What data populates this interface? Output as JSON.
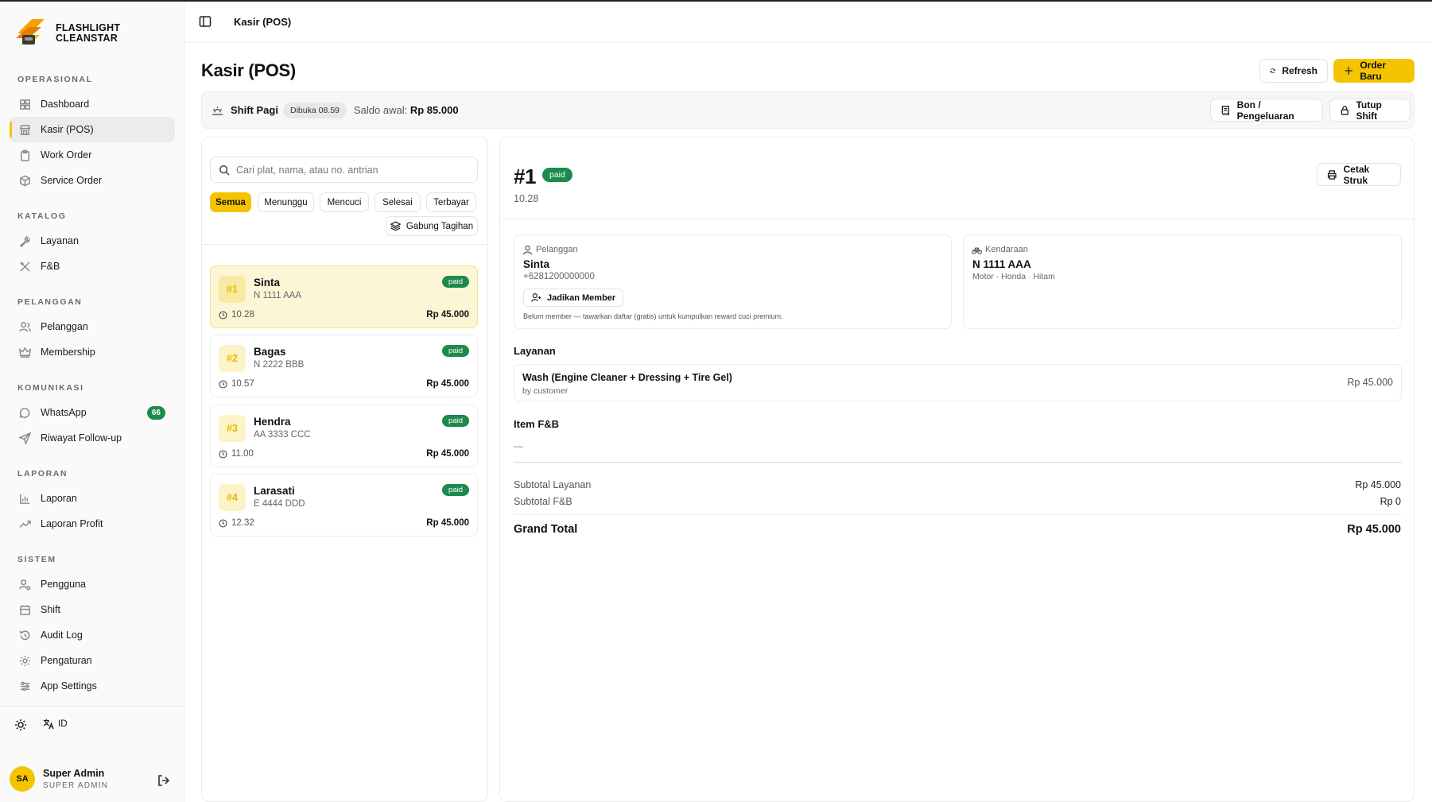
{
  "brand": {
    "line1": "FLASHLIGHT",
    "line2": "CLEANSTAR"
  },
  "header": {
    "title": "Kasir (POS)"
  },
  "sidebar": {
    "sections": [
      {
        "title": "OPERASIONAL",
        "items": [
          {
            "label": "Dashboard",
            "icon": "grid-icon"
          },
          {
            "label": "Kasir (POS)",
            "icon": "store-icon",
            "active": true
          },
          {
            "label": "Work Order",
            "icon": "clipboard-icon"
          },
          {
            "label": "Service Order",
            "icon": "box-icon"
          }
        ]
      },
      {
        "title": "KATALOG",
        "items": [
          {
            "label": "Layanan",
            "icon": "wrench-icon"
          },
          {
            "label": "F&B",
            "icon": "utensils-icon"
          }
        ]
      },
      {
        "title": "PELANGGAN",
        "items": [
          {
            "label": "Pelanggan",
            "icon": "users-icon"
          },
          {
            "label": "Membership",
            "icon": "crown-icon"
          }
        ]
      },
      {
        "title": "KOMUNIKASI",
        "items": [
          {
            "label": "WhatsApp",
            "icon": "chat-icon",
            "badge": "66"
          },
          {
            "label": "Riwayat Follow-up",
            "icon": "send-icon"
          }
        ]
      },
      {
        "title": "LAPORAN",
        "items": [
          {
            "label": "Laporan",
            "icon": "bar-chart-icon"
          },
          {
            "label": "Laporan Profit",
            "icon": "trending-up-icon"
          }
        ]
      },
      {
        "title": "SISTEM",
        "items": [
          {
            "label": "Pengguna",
            "icon": "user-cog-icon"
          },
          {
            "label": "Shift",
            "icon": "calendar-icon"
          },
          {
            "label": "Audit Log",
            "icon": "history-icon"
          },
          {
            "label": "Pengaturan",
            "icon": "gear-icon"
          },
          {
            "label": "App Settings",
            "icon": "sliders-icon"
          }
        ]
      }
    ],
    "language": "ID",
    "user": {
      "initials": "SA",
      "name": "Super Admin",
      "role": "SUPER ADMIN"
    }
  },
  "main": {
    "title": "Kasir (POS)",
    "refresh_label": "Refresh",
    "new_order_label": "Order Baru",
    "shift": {
      "name": "Shift Pagi",
      "opened": "Dibuka 08.59",
      "saldo_label": "Saldo awal:",
      "saldo_value": "Rp 85.000",
      "bon_label": "Bon / Pengeluaran",
      "close_label": "Tutup Shift"
    },
    "search_placeholder": "Cari plat, nama, atau no. antrian",
    "filters": [
      "Semua",
      "Menunggu",
      "Mencuci",
      "Selesai",
      "Terbayar"
    ],
    "merge_label": "Gabung Tagihan",
    "orders": [
      {
        "num": "#1",
        "name": "Sinta",
        "plate": "N 1111 AAA",
        "time": "10.28",
        "price": "Rp 45.000",
        "status": "paid"
      },
      {
        "num": "#2",
        "name": "Bagas",
        "plate": "N 2222 BBB",
        "time": "10.57",
        "price": "Rp 45.000",
        "status": "paid"
      },
      {
        "num": "#3",
        "name": "Hendra",
        "plate": "AA 3333 CCC",
        "time": "11.00",
        "price": "Rp 45.000",
        "status": "paid"
      },
      {
        "num": "#4",
        "name": "Larasati",
        "plate": "E 4444 DDD",
        "time": "12.32",
        "price": "Rp 45.000",
        "status": "paid"
      }
    ]
  },
  "detail": {
    "num": "#1",
    "status": "paid",
    "time": "10.28",
    "print_label": "Cetak Struk",
    "customer": {
      "label": "Pelanggan",
      "name": "Sinta",
      "phone": "+6281200000000",
      "member_btn": "Jadikan Member",
      "note": "Belum member — tawarkan daftar (gratis) untuk kumpulkan reward cuci premium."
    },
    "vehicle": {
      "label": "Kendaraan",
      "plate": "N 1111 AAA",
      "desc": "Motor · Honda · Hitam"
    },
    "services_title": "Layanan",
    "service": {
      "name": "Wash (Engine Cleaner + Dressing + Tire Gel)",
      "by": "by customer",
      "price": "Rp 45.000"
    },
    "fnb_title": "Item F&B",
    "fnb_empty": "—",
    "subtotal_service_label": "Subtotal Layanan",
    "subtotal_service_value": "Rp 45.000",
    "subtotal_fnb_label": "Subtotal F&B",
    "subtotal_fnb_value": "Rp 0",
    "grand_label": "Grand Total",
    "grand_value": "Rp 45.000"
  },
  "colors": {
    "accent": "#f5c400",
    "paid": "#1d8a4c",
    "active_card": "#fdf6d6"
  }
}
